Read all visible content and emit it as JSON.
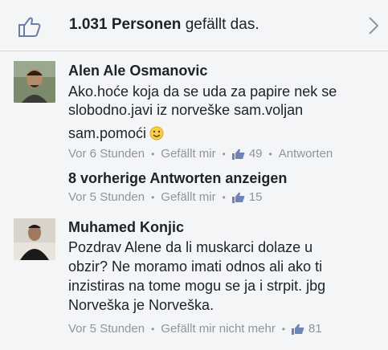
{
  "likes_bar": {
    "count": "1.031 Personen",
    "suffix": " gefällt das.",
    "icon": "thumbs-up-icon",
    "chevron_icon": "chevron-right-icon"
  },
  "comments": [
    {
      "author": "Alen Ale Osmanovic",
      "lines": [
        "Ako.hoće koja da se uda za papire nek se",
        "slobodno.javi iz norveške sam.voljan",
        "sam.pomoći"
      ],
      "emoji": "smiley-icon",
      "time": "Vor 6 Stunden",
      "like_action": "Gefällt mir",
      "like_count": "49",
      "reply_action": "Antworten"
    },
    {
      "author": "Muhamed Konjic",
      "lines": [
        "Pozdrav Alene da li muskarci dolaze u",
        "obzir? Ne moramo imati odnos ali ako ti",
        "inzistiras na tome mogu se ja i strpit. jbg",
        "Norveška je Norveška."
      ],
      "time": "Vor 5 Stunden",
      "like_action": "Gefällt mir nicht mehr",
      "like_count": "81"
    }
  ],
  "previous_replies": {
    "label": "8 vorherige Antworten anzeigen",
    "time": "Vor 5 Stunden",
    "like_action": "Gefällt mir",
    "like_count": "15"
  },
  "colors": {
    "background": "#f4f5f7",
    "text": "#1d2129",
    "meta": "#90949c",
    "like_blue": "#6d84b4"
  }
}
